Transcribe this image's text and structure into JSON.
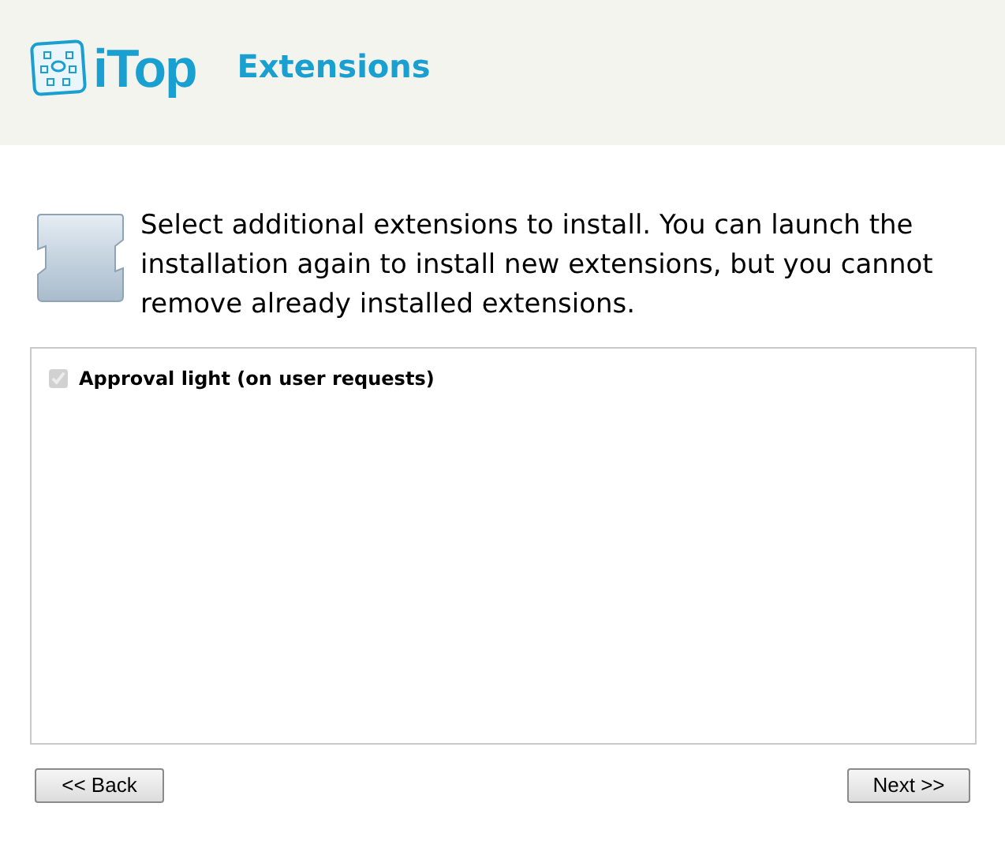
{
  "header": {
    "logo_text": "iTop",
    "title": "Extensions"
  },
  "intro": "Select additional extensions to install. You can launch the installation again to install new extensions, but you cannot remove already installed extensions.",
  "extensions": [
    {
      "label": "Approval light (on user requests)",
      "checked": true,
      "disabled": true
    }
  ],
  "buttons": [
    {
      "label": "<< Back"
    },
    {
      "label": "Next >>"
    }
  ]
}
